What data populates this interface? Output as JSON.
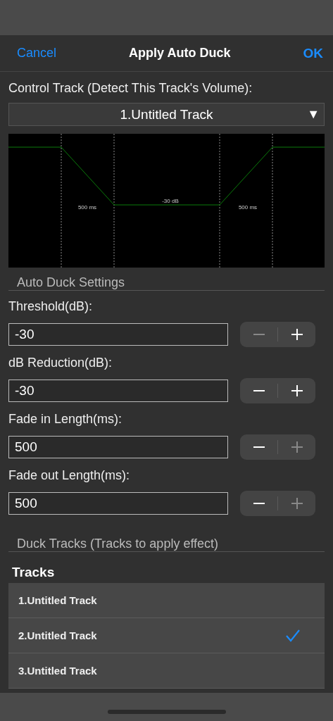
{
  "nav": {
    "cancel": "Cancel",
    "title": "Apply Auto Duck",
    "ok": "OK"
  },
  "control_track": {
    "label": "Control Track (Detect This Track's Volume):",
    "value": "1.Untitled Track",
    "caret": "▼"
  },
  "graph": {
    "fade_in_label": "500 ms",
    "reduction_label": "-30 dB",
    "fade_out_label": "500 ms"
  },
  "settings_header": "Auto Duck Settings",
  "fields": [
    {
      "label": "Threshold(dB):",
      "value": "-30",
      "minus_disabled": true,
      "plus_disabled": false
    },
    {
      "label": "dB Reduction(dB):",
      "value": "-30",
      "minus_disabled": false,
      "plus_disabled": false
    },
    {
      "label": "Fade in Length(ms):",
      "value": "500",
      "minus_disabled": false,
      "plus_disabled": true
    },
    {
      "label": "Fade out Length(ms):",
      "value": "500",
      "minus_disabled": false,
      "plus_disabled": true
    }
  ],
  "duck_header": "Duck Tracks (Tracks to apply effect)",
  "tracks_title": "Tracks",
  "tracks": [
    {
      "name": "1.Untitled Track",
      "selected": false
    },
    {
      "name": "2.Untitled Track",
      "selected": true
    },
    {
      "name": "3.Untitled Track",
      "selected": false
    }
  ]
}
